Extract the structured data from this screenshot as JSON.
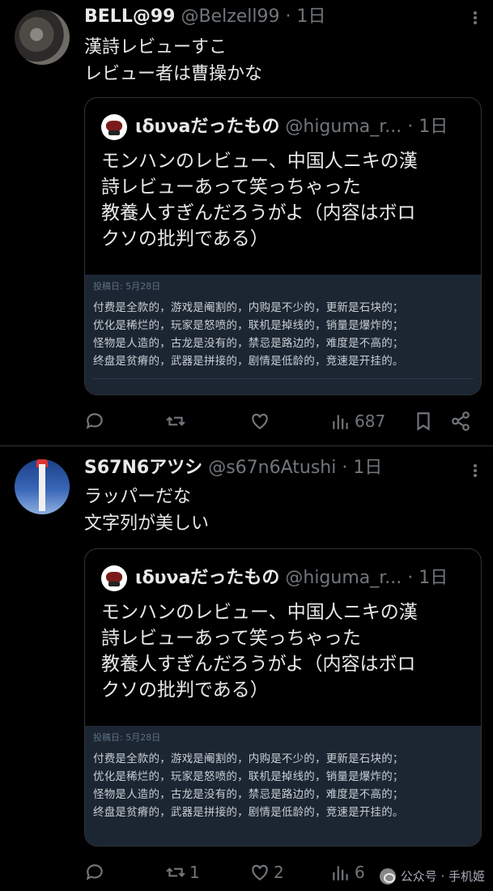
{
  "tweets": [
    {
      "name": "BELL@99",
      "handle": "@Belzell99 · 1日",
      "text_lines": [
        "漢詩レビューすこ",
        "レビュー者は曹操かな"
      ],
      "quote": {
        "name": "ιδυνaだったもの",
        "handle": "@higuma_r... · 1日",
        "text_lines": [
          "モンハンのレビュー、中国人ニキの漢",
          "詩レビューあって笑っちゃった",
          "教養人すぎんだろうがよ（内容はボロ",
          "クソの批判である）"
        ],
        "image_date": "投稿日: 5月28日",
        "image_lines": [
          "付费是全款的，游戏是阉割的，内购是不少的，更新是石块的；",
          "优化是稀烂的，玩家是怒喷的，联机是掉线的，销量是爆炸的；",
          "怪物是人造的，古龙是没有的，禁忌是路边的，难度是不高的；",
          "终盘是贫瘠的，武器是拼接的，剧情是低龄的，竞速是开挂的。"
        ]
      },
      "actions": {
        "reply": "",
        "retweet": "",
        "like": "",
        "views": "687"
      }
    },
    {
      "name": "S67N6アツシ",
      "handle": "@s67n6Atushi · 1日",
      "text_lines": [
        "ラッパーだな",
        "文字列が美しい"
      ],
      "quote": {
        "name": "ιδυνaだったもの",
        "handle": "@higuma_r... · 1日",
        "text_lines": [
          "モンハンのレビュー、中国人ニキの漢",
          "詩レビューあって笑っちゃった",
          "教養人すぎんだろうがよ（内容はボロ",
          "クソの批判である）"
        ],
        "image_date": "投稿日: 5月28日",
        "image_lines": [
          "付费是全款的，游戏是阉割的，内购是不少的，更新是石块的；",
          "优化是稀烂的，玩家是怒喷的，联机是掉线的，销量是爆炸的；",
          "怪物是人造的，古龙是没有的，禁忌是路边的，难度是不高的；",
          "终盘是贫瘠的，武器是拼接的，剧情是低龄的，竞速是开挂的。"
        ]
      },
      "actions": {
        "reply": "",
        "retweet": "1",
        "like": "2",
        "views": "6"
      }
    }
  ],
  "watermark": "公众号 · 手机姬",
  "icons": {
    "reply": "reply-icon",
    "retweet": "retweet-icon",
    "like": "heart-icon",
    "views": "views-icon",
    "bookmark": "bookmark-icon",
    "share": "share-icon",
    "more": "more-icon"
  }
}
